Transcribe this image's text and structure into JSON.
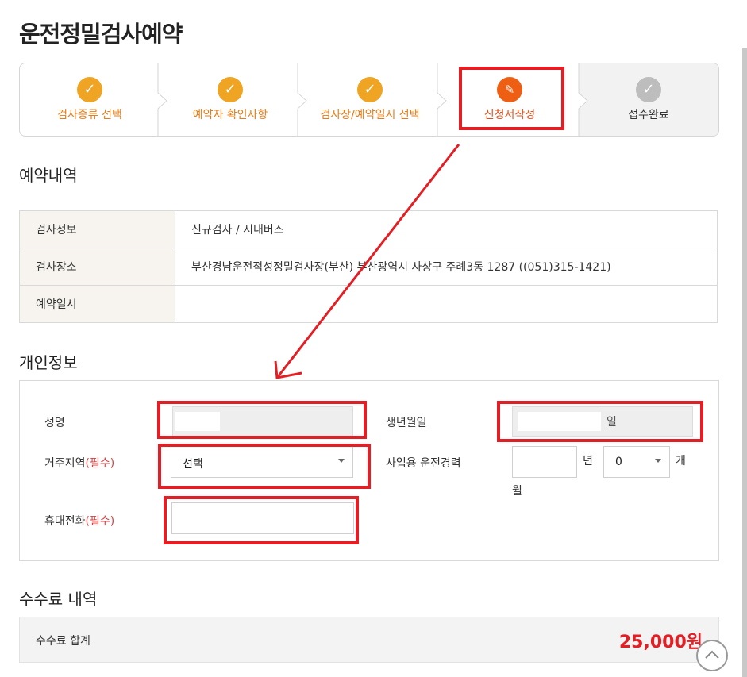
{
  "page": {
    "title": "운전정밀검사예약"
  },
  "steps": [
    {
      "label": "검사종류 선택",
      "status": "done",
      "icon": "check-icon"
    },
    {
      "label": "예약자 확인사항",
      "status": "done",
      "icon": "check-icon"
    },
    {
      "label": "검사장/예약일시 선택",
      "status": "done",
      "icon": "check-icon"
    },
    {
      "label": "신청서작성",
      "status": "current",
      "icon": "pencil-icon"
    },
    {
      "label": "접수완료",
      "status": "pending",
      "icon": "check-icon"
    }
  ],
  "reservation": {
    "title": "예약내역",
    "rows": [
      {
        "label": "검사정보",
        "value": "신규검사 / 시내버스"
      },
      {
        "label": "검사장소",
        "value": "부산경남운전적성정밀검사장(부산) 부산광역시 사상구 주례3동 1287 ((051)315-1421)"
      },
      {
        "label": "예약일시",
        "value": ""
      }
    ]
  },
  "personal": {
    "title": "개인정보",
    "name_label": "성명",
    "birth_label": "생년월일",
    "birth_suffix": "일",
    "region_label": "거주지역",
    "required_tag": "(필수)",
    "region_value": "선택",
    "experience_label": "사업용 운전경력",
    "years_unit": "년",
    "months_value": "0",
    "months_unit": "개",
    "months_unit_2": "월",
    "phone_label": "휴대전화",
    "phone_required_tag": "(필수)"
  },
  "fee": {
    "title": "수수료 내역",
    "total_label": "수수료 합계",
    "total_value": "25,000원"
  },
  "colors": {
    "accent": "#f0a423",
    "current": "#ef5f13",
    "annotation": "#e31e24"
  }
}
